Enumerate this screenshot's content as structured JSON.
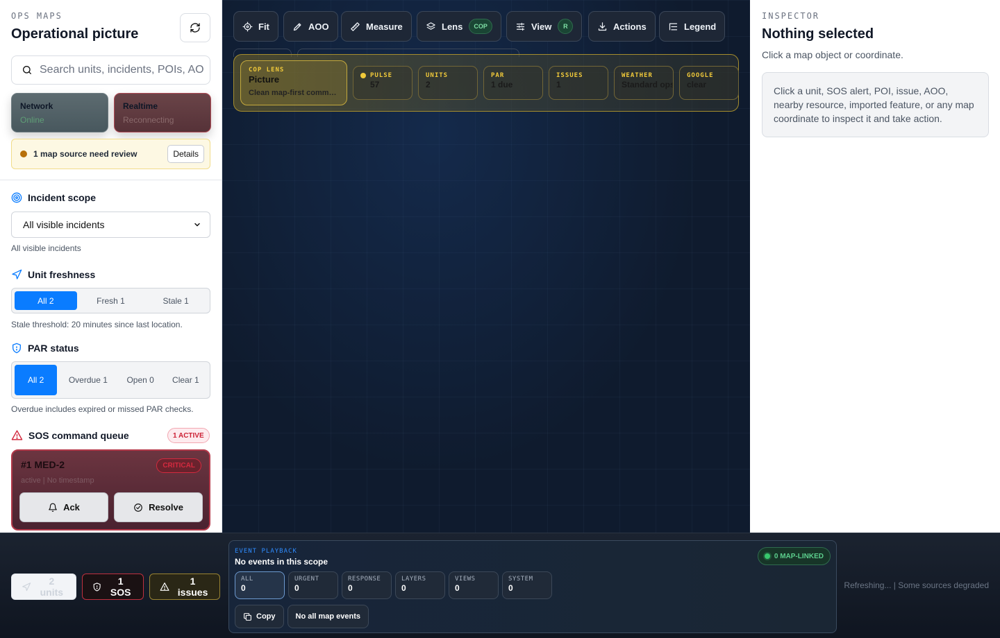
{
  "left": {
    "eyebrow": "OPS MAPS",
    "title": "Operational picture",
    "search_placeholder": "Search units, incidents, POIs, AOs",
    "network": {
      "label": "Network",
      "value": "Online"
    },
    "realtime": {
      "label": "Realtime",
      "value": "Reconnecting"
    },
    "review": {
      "text": "1 map source need review",
      "button": "Details"
    },
    "incident_scope": {
      "heading": "Incident scope",
      "selected": "All visible incidents",
      "hint": "All visible incidents"
    },
    "freshness": {
      "heading": "Unit freshness",
      "options": [
        "All 2",
        "Fresh 1",
        "Stale 1"
      ],
      "hint": "Stale threshold: 20 minutes since last location."
    },
    "par": {
      "heading": "PAR status",
      "options": [
        "All 2",
        "Overdue 1",
        "Open 0",
        "Clear 1"
      ],
      "hint": "Overdue includes expired or missed PAR checks."
    },
    "sos": {
      "heading": "SOS command queue",
      "badge": "1 ACTIVE",
      "card": {
        "name": "#1 MED-2",
        "severity": "CRITICAL",
        "meta": "active | No timestamp",
        "ack": "Ack",
        "resolve": "Resolve"
      }
    }
  },
  "toolbar": {
    "fit": "Fit",
    "aoo": "AOO",
    "measure": "Measure",
    "lens": "Lens",
    "lens_pill": "COP",
    "view": "View",
    "view_pill": "R",
    "actions": "Actions",
    "legend": "Legend"
  },
  "lens_panel": {
    "main": {
      "key": "COP LENS",
      "value": "Picture",
      "sub": "Clean map-first command view"
    },
    "metrics": [
      {
        "key": "PULSE",
        "value": "57"
      },
      {
        "key": "UNITS",
        "value": "2"
      },
      {
        "key": "PAR",
        "value": "1 due"
      },
      {
        "key": "ISSUES",
        "value": "1"
      },
      {
        "key": "WEATHER",
        "value": "Standard ops"
      },
      {
        "key": "GOOGLE",
        "value": "clear"
      }
    ]
  },
  "inspector": {
    "eyebrow": "INSPECTOR",
    "title": "Nothing selected",
    "subtitle": "Click a map object or coordinate.",
    "help": "Click a unit, SOS alert, POI, issue, AOO, nearby resource, imported feature, or any map coordinate to inspect it and take action."
  },
  "bottom": {
    "units": "2 units",
    "sos": "1 SOS",
    "issues": "1 issues",
    "playback": {
      "key": "EVENT PLAYBACK",
      "title": "No events in this scope",
      "linked": "0 MAP-LINKED",
      "filters": [
        {
          "key": "ALL",
          "value": "0"
        },
        {
          "key": "URGENT",
          "value": "0"
        },
        {
          "key": "RESPONSE",
          "value": "0"
        },
        {
          "key": "LAYERS",
          "value": "0"
        },
        {
          "key": "VIEWS",
          "value": "0"
        },
        {
          "key": "SYSTEM",
          "value": "0"
        }
      ],
      "copy": "Copy",
      "scope_button": "No all map events"
    },
    "status": "Refreshing... | Some sources degraded"
  },
  "colors": {
    "accent": "#0a7cff",
    "critical": "#d32a3f",
    "lens_gold": "#f0c93a",
    "ok_green": "#38c76d"
  }
}
